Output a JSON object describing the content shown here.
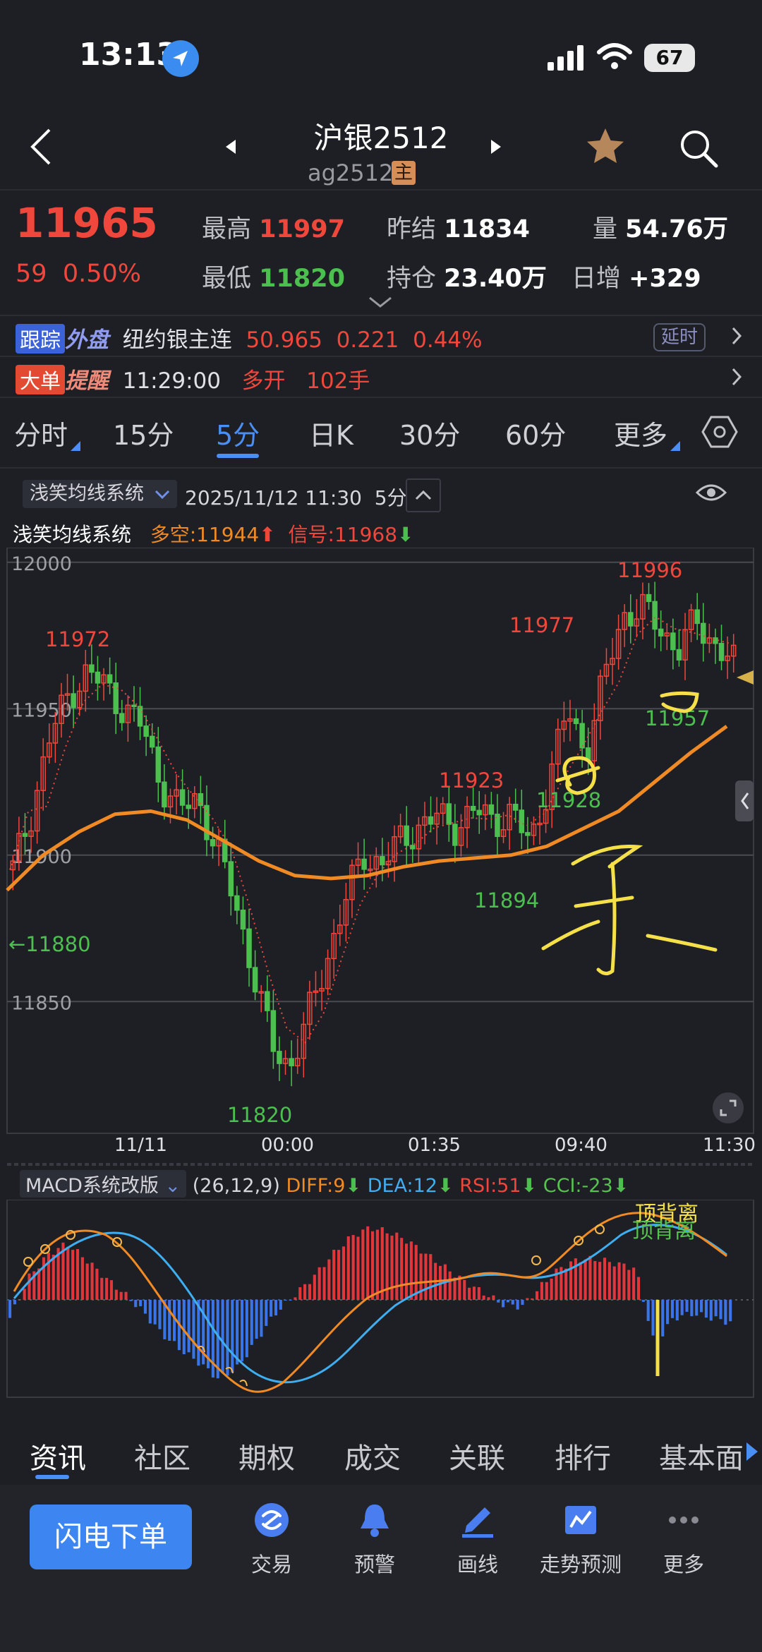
{
  "status_bar": {
    "time": "13:13",
    "battery": "67"
  },
  "header": {
    "title": "沪银2512",
    "code": "ag2512",
    "main_badge": "主"
  },
  "quote": {
    "price": "11965",
    "change": "59",
    "change_pct": "0.50%",
    "high_label": "最高",
    "high": "11997",
    "low_label": "最低",
    "low": "11820",
    "prev_settle_label": "昨结",
    "prev_settle": "11834",
    "open_interest_label": "持仓",
    "open_interest": "23.40万",
    "volume_label": "量",
    "volume": "54.76万",
    "daily_add_label": "日增",
    "daily_add": "+329"
  },
  "external": {
    "badge1": "跟踪",
    "badge2": "外盘",
    "name": "纽约银主连",
    "price": "50.965",
    "change": "0.221",
    "pct": "0.44%",
    "delay": "延时"
  },
  "alert": {
    "badge1": "大单",
    "badge2": "提醒",
    "time": "11:29:00",
    "type": "多开",
    "qty": "102手"
  },
  "periods": {
    "p1": "分时",
    "p2": "15分",
    "p3": "5分",
    "p4": "日K",
    "p5": "30分",
    "p6": "60分",
    "p7": "更多"
  },
  "chart_toolbar": {
    "system": "浅笑均线系统",
    "datetime": "2025/11/12 11:30",
    "period": "5分"
  },
  "indicator": {
    "name": "浅笑均线系统",
    "long_short": "多空:11944",
    "signal": "信号:11968"
  },
  "macd": {
    "selector": "MACD系统改版",
    "params": "(26,12,9)",
    "diff": "DIFF:9",
    "dea": "DEA:12",
    "rsi": "RSI:51",
    "cci": "CCI:-23",
    "note1": "顶背离",
    "note2": "顶背离"
  },
  "info_tabs": {
    "t1": "资讯",
    "t2": "社区",
    "t3": "期权",
    "t4": "成交",
    "t5": "关联",
    "t6": "排行",
    "t7": "基本面"
  },
  "dock": {
    "flash": "闪电下单",
    "trade": "交易",
    "alert": "预警",
    "draw": "画线",
    "forecast": "走势预测",
    "more": "更多"
  },
  "colors": {
    "up": "#f0473c",
    "down": "#4cc04f",
    "accent": "#4a8ff5",
    "ma": "#f08a24",
    "dea": "#3eaef0",
    "annotation": "#f5e04a"
  },
  "chart_data": {
    "type": "candlestick",
    "y_ticks": [
      "12000",
      "11950",
      "11900",
      "11850"
    ],
    "ylim": [
      11805,
      12005
    ],
    "x_ticks": [
      "11/11",
      "00:00",
      "01:35",
      "09:40",
      "11:30"
    ],
    "annotations": [
      "11972",
      "11820",
      "11923",
      "11894",
      "11977",
      "11996",
      "11928",
      "11957",
      "←11880"
    ],
    "close_path": [
      11895,
      11915,
      11940,
      11955,
      11962,
      11958,
      11950,
      11944,
      11925,
      11915,
      11920,
      11902,
      11885,
      11860,
      11835,
      11828,
      11845,
      11865,
      11885,
      11900,
      11897,
      11905,
      11910,
      11913,
      11910,
      11915,
      11912,
      11914,
      11904,
      11925,
      11950,
      11935,
      11960,
      11982,
      11984,
      11978,
      11970,
      11980,
      11972,
      11965
    ],
    "ma_line": [
      11888,
      11900,
      11908,
      11914,
      11915,
      11912,
      11905,
      11898,
      11893,
      11892,
      11893,
      11896,
      11898,
      11899,
      11900,
      11903,
      11909,
      11915,
      11925,
      11935,
      11944
    ],
    "macd_hist": [
      -8,
      10,
      20,
      25,
      18,
      10,
      3,
      -5,
      -15,
      -22,
      -28,
      -35,
      -30,
      -18,
      -6,
      2,
      10,
      20,
      28,
      32,
      30,
      26,
      20,
      14,
      8,
      3,
      -2,
      -3,
      6,
      14,
      18,
      18,
      16,
      14,
      -20,
      -8,
      -6,
      -8,
      -10
    ]
  }
}
